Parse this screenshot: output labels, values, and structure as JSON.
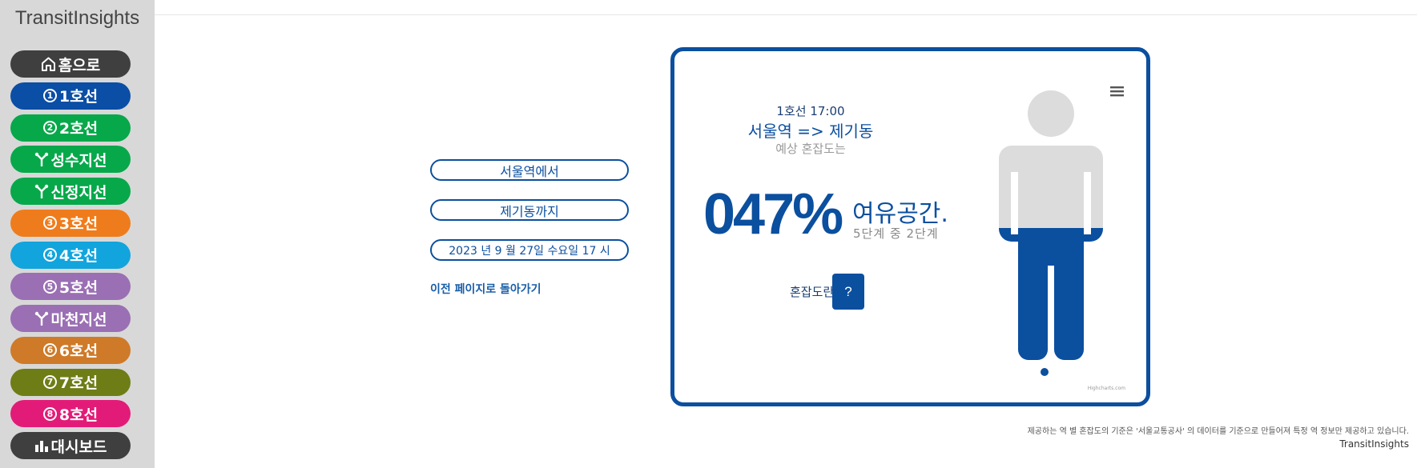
{
  "sidebar": {
    "brand": "TransitInsights",
    "items": [
      {
        "label": "홈으로",
        "glyph": "",
        "icon": "home-icon",
        "color": "#3f3f3f"
      },
      {
        "label": "1호선",
        "glyph": "1",
        "icon": "line-1-icon",
        "color": "#0a4ea6"
      },
      {
        "label": "2호선",
        "glyph": "2",
        "icon": "line-2-icon",
        "color": "#07a84a"
      },
      {
        "label": "성수지선",
        "glyph": "",
        "icon": "branch-icon",
        "color": "#07a84a"
      },
      {
        "label": "신정지선",
        "glyph": "",
        "icon": "branch-icon",
        "color": "#07a84a"
      },
      {
        "label": "3호선",
        "glyph": "3",
        "icon": "line-3-icon",
        "color": "#ef7c1c"
      },
      {
        "label": "4호선",
        "glyph": "4",
        "icon": "line-4-icon",
        "color": "#12a4dd"
      },
      {
        "label": "5호선",
        "glyph": "5",
        "icon": "line-5-icon",
        "color": "#9a6fb3"
      },
      {
        "label": "마천지선",
        "glyph": "",
        "icon": "branch-icon",
        "color": "#9a6fb3"
      },
      {
        "label": "6호선",
        "glyph": "6",
        "icon": "line-6-icon",
        "color": "#cf7a28"
      },
      {
        "label": "7호선",
        "glyph": "7",
        "icon": "line-7-icon",
        "color": "#6f7d17"
      },
      {
        "label": "8호선",
        "glyph": "8",
        "icon": "line-8-icon",
        "color": "#e31b78"
      },
      {
        "label": "대시보드",
        "glyph": "",
        "icon": "bar-chart-icon",
        "color": "#3f3f3f"
      }
    ]
  },
  "form": {
    "from": "서울역에서",
    "to": "제기동까지",
    "datetime": "2023 년 9 월 27일 수요일 17 시",
    "back_link": "이전 페이지로 돌아가기"
  },
  "card": {
    "line_time": "1호선 17:00",
    "route": "서울역 => 제기동",
    "predicted_label": "예상 혼잡도는",
    "percent": "047%",
    "status": "여유공간.",
    "stage": "5단계 중 2단계",
    "help_label": "혼잡도란",
    "help_button": "?",
    "credit": "Highcharts.com",
    "fill_fraction": 0.47,
    "accent_color": "#0b4f9f",
    "empty_color": "#dcdcdc"
  },
  "footer": {
    "note": "제공하는 역 별 혼잡도의 기준은 '서울교통공사' 의 데이터를 기준으로 만들어져 특정 역 정보만 제공하고 있습니다.",
    "brand": "TransitInsights"
  }
}
